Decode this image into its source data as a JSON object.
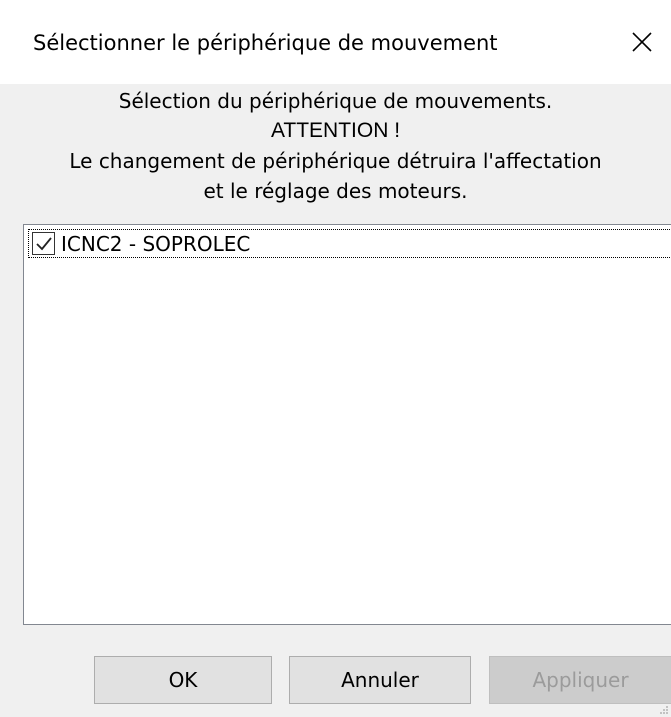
{
  "window": {
    "title": "Sélectionner le périphérique de mouvement"
  },
  "icons": {
    "close": "close-icon",
    "check": "checkmark-icon",
    "grip": "resize-grip-icon"
  },
  "message": {
    "lines": [
      "Sélection du périphérique de mouvements.",
      "ATTENTION !",
      "Le changement de périphérique détruira l'affectation",
      "et le réglage des moteurs."
    ]
  },
  "device_list": {
    "items": [
      {
        "label": "ICNC2 - SOPROLEC",
        "checked": true
      }
    ]
  },
  "buttons": {
    "ok": "OK",
    "cancel": "Annuler",
    "apply": "Appliquer",
    "apply_enabled": false
  },
  "colors": {
    "title_bg": "#ffffff",
    "dialog_bg": "#f0f0f0",
    "button_bg": "#e1e1e1",
    "button_disabled_bg": "#cccccc",
    "button_disabled_text": "#9b9b9b",
    "list_border": "#828790"
  }
}
